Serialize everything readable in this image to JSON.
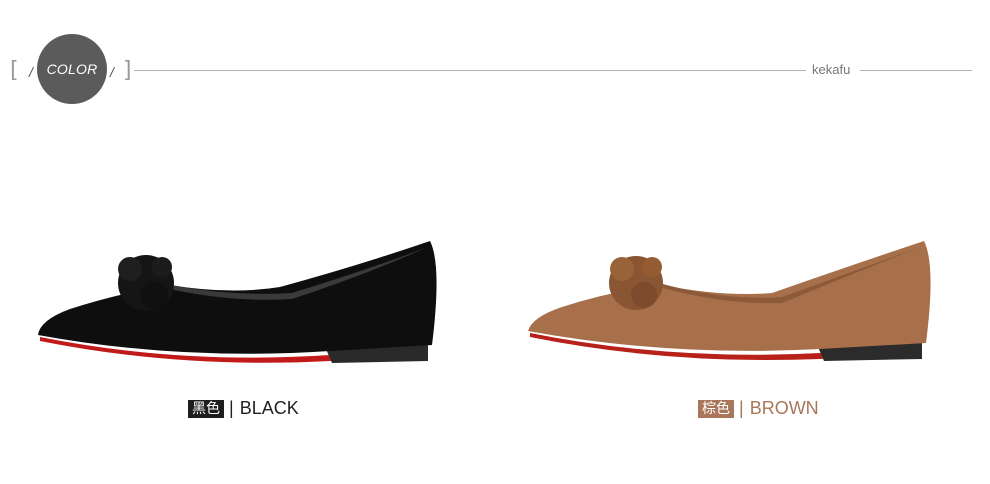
{
  "header": {
    "badge_label": "COLOR",
    "brand": "kekafu"
  },
  "colors": {
    "badge_bg": "#5b5b5b",
    "black_tag": "#1e1e1e",
    "brown_tag": "#a9765a",
    "brown_text": "#a9765a",
    "black_text": "#222222"
  },
  "variants": [
    {
      "tag": "黑色",
      "separator": "|",
      "name": "BLACK"
    },
    {
      "tag": "棕色",
      "separator": "|",
      "name": "BROWN"
    }
  ]
}
